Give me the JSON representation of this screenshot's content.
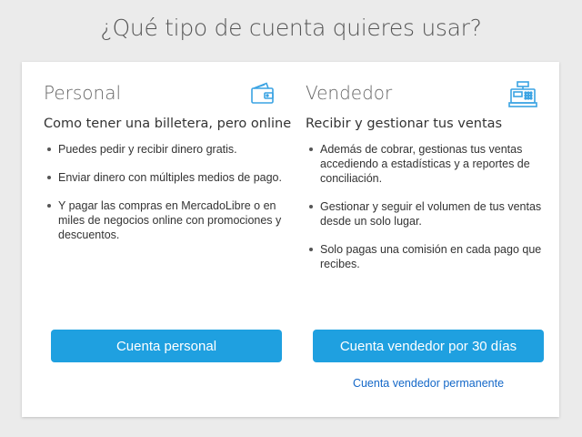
{
  "page": {
    "title": "¿Qué tipo de cuenta quieres usar?"
  },
  "personal": {
    "title": "Personal",
    "icon": "wallet-icon",
    "subtitle": "Como tener una billetera, pero online",
    "bullets": [
      "Puedes pedir y recibir dinero gratis.",
      "Enviar dinero con múltiples medios de pago.",
      "Y pagar las compras en MercadoLibre o en miles de negocios online con promociones y descuentos."
    ],
    "button_label": "Cuenta personal"
  },
  "seller": {
    "title": "Vendedor",
    "icon": "cash-register-icon",
    "subtitle": "Recibir y gestionar tus ventas",
    "bullets": [
      "Además de cobrar, gestionas tus ventas accediendo a estadísticas y a reportes de conciliación.",
      "Gestionar y seguir el volumen de tus ventas desde un solo lugar.",
      "Solo pagas una comisión en cada pago que recibes."
    ],
    "button_label": "Cuenta vendedor por 30 días",
    "link_label": "Cuenta vendedor permanente"
  },
  "colors": {
    "background": "#ebebeb",
    "button": "#1fa0e0",
    "link": "#1468c8",
    "icon": "#3aa3e3"
  }
}
